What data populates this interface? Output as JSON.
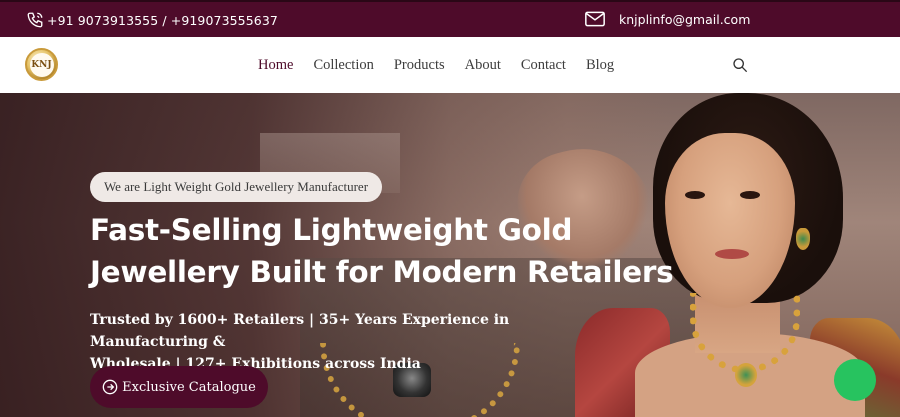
{
  "topbar": {
    "phone": "+91 9073913555 / +919073555637",
    "email": "knjplinfo@gmail.com",
    "phone_icon": "phone-icon",
    "email_icon": "mail-icon"
  },
  "brand": {
    "logo_text": "KNJ"
  },
  "nav": {
    "items": [
      {
        "label": "Home",
        "active": true
      },
      {
        "label": "Collection"
      },
      {
        "label": "Products"
      },
      {
        "label": "About"
      },
      {
        "label": "Contact"
      },
      {
        "label": "Blog"
      }
    ],
    "search_icon": "search-icon"
  },
  "hero": {
    "badge": "We are Light Weight Gold Jewellery Manufacturer",
    "headline_line1": "Fast-Selling Lightweight Gold",
    "headline_line2": "Jewellery Built for Modern Retailers",
    "subtext_line1": "Trusted by 1600+ Retailers | 35+ Years Experience in Manufacturing &",
    "subtext_line2": "Wholesale |  127+ Exhibitions across India",
    "cta_label": "Exclusive Catalogue",
    "cta_icon": "arrow-circle-icon"
  },
  "chat": {
    "icon": "chat-icon"
  },
  "colors": {
    "brand": "#4e0b2a",
    "chat": "#27c35f"
  }
}
